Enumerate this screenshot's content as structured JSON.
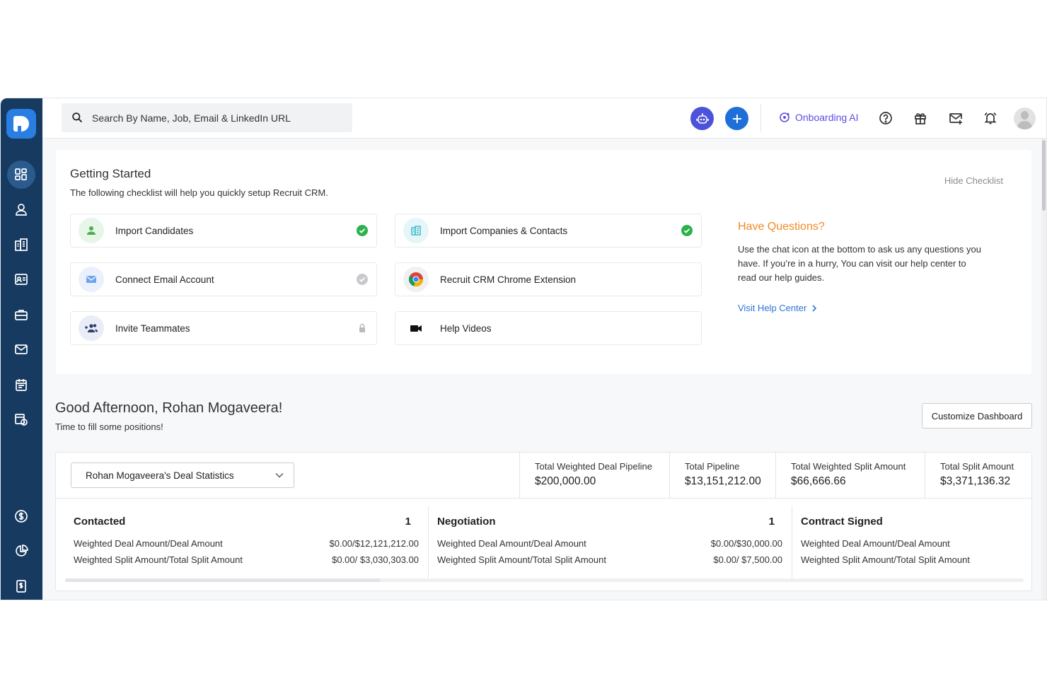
{
  "search": {
    "placeholder": "Search By Name, Job, Email & LinkedIn URL"
  },
  "topbar": {
    "onboarding_label": "Onboarding AI"
  },
  "sidebar": {
    "items": [
      {
        "name": "dashboard",
        "icon": "dashboard-icon"
      },
      {
        "name": "candidates",
        "icon": "candidates-icon"
      },
      {
        "name": "companies",
        "icon": "companies-icon"
      },
      {
        "name": "contacts",
        "icon": "contacts-icon"
      },
      {
        "name": "jobs",
        "icon": "briefcase-icon"
      },
      {
        "name": "email",
        "icon": "mail-icon"
      },
      {
        "name": "calendar",
        "icon": "calendar-icon"
      },
      {
        "name": "tasks",
        "icon": "task-clock-icon"
      },
      {
        "name": "deals",
        "icon": "dollar-icon"
      },
      {
        "name": "reports",
        "icon": "pie-chart-icon"
      },
      {
        "name": "invoices",
        "icon": "invoice-icon"
      }
    ]
  },
  "getting_started": {
    "title": "Getting Started",
    "subtitle": "The following checklist will help you quickly setup Recruit CRM.",
    "hide_label": "Hide Checklist",
    "tasks": [
      {
        "label": "Import Candidates",
        "status": "done",
        "icon": "user-icon"
      },
      {
        "label": "Import Companies & Contacts",
        "status": "done",
        "icon": "building-icon"
      },
      {
        "label": "Connect Email Account",
        "status": "pending",
        "icon": "mail-icon"
      },
      {
        "label": "Recruit CRM Chrome Extension",
        "status": "none",
        "icon": "chrome-icon"
      },
      {
        "label": "Invite Teammates",
        "status": "locked",
        "icon": "add-people-icon"
      },
      {
        "label": "Help Videos",
        "status": "none",
        "icon": "video-camera-icon"
      }
    ],
    "questions": {
      "title": "Have Questions?",
      "text": "Use the chat icon at the bottom to ask us any questions you have. If you’re in a hurry, You can visit our help center to read our help guides.",
      "link_label": "Visit Help Center"
    }
  },
  "greeting": {
    "title": "Good Afternoon, Rohan Mogaveera!",
    "subtitle": "Time to fill some positions!",
    "customize_label": "Customize Dashboard"
  },
  "deals": {
    "selector": "Rohan Mogaveera's Deal Statistics",
    "stats": [
      {
        "label": "Total Weighted Deal Pipeline",
        "value": "$200,000.00"
      },
      {
        "label": "Total Pipeline",
        "value": "$13,151,212.00"
      },
      {
        "label": "Total Weighted Split Amount",
        "value": "$66,666.66"
      },
      {
        "label": "Total Split Amount",
        "value": "$3,371,136.32"
      }
    ],
    "stages": [
      {
        "name": "Contacted",
        "count": "1",
        "rows": [
          {
            "label": "Weighted Deal Amount/Deal Amount",
            "value": "$0.00/$12,121,212.00"
          },
          {
            "label": "Weighted Split Amount/Total Split Amount",
            "value": "$0.00/ $3,030,303.00"
          }
        ]
      },
      {
        "name": "Negotiation",
        "count": "1",
        "rows": [
          {
            "label": "Weighted Deal Amount/Deal Amount",
            "value": "$0.00/$30,000.00"
          },
          {
            "label": "Weighted Split Amount/Total Split Amount",
            "value": "$0.00/ $7,500.00"
          }
        ]
      },
      {
        "name": "Contract Signed",
        "count": "",
        "rows": [
          {
            "label": "Weighted Deal Amount/Deal Amount",
            "value": ""
          },
          {
            "label": "Weighted Split Amount/Total Split Amount",
            "value": ""
          }
        ]
      }
    ]
  },
  "colors": {
    "sidebar": "#173a61",
    "accent": "#1f6fd8",
    "success": "#2bb24c",
    "orange": "#f08a24",
    "link": "#2a73d9"
  }
}
